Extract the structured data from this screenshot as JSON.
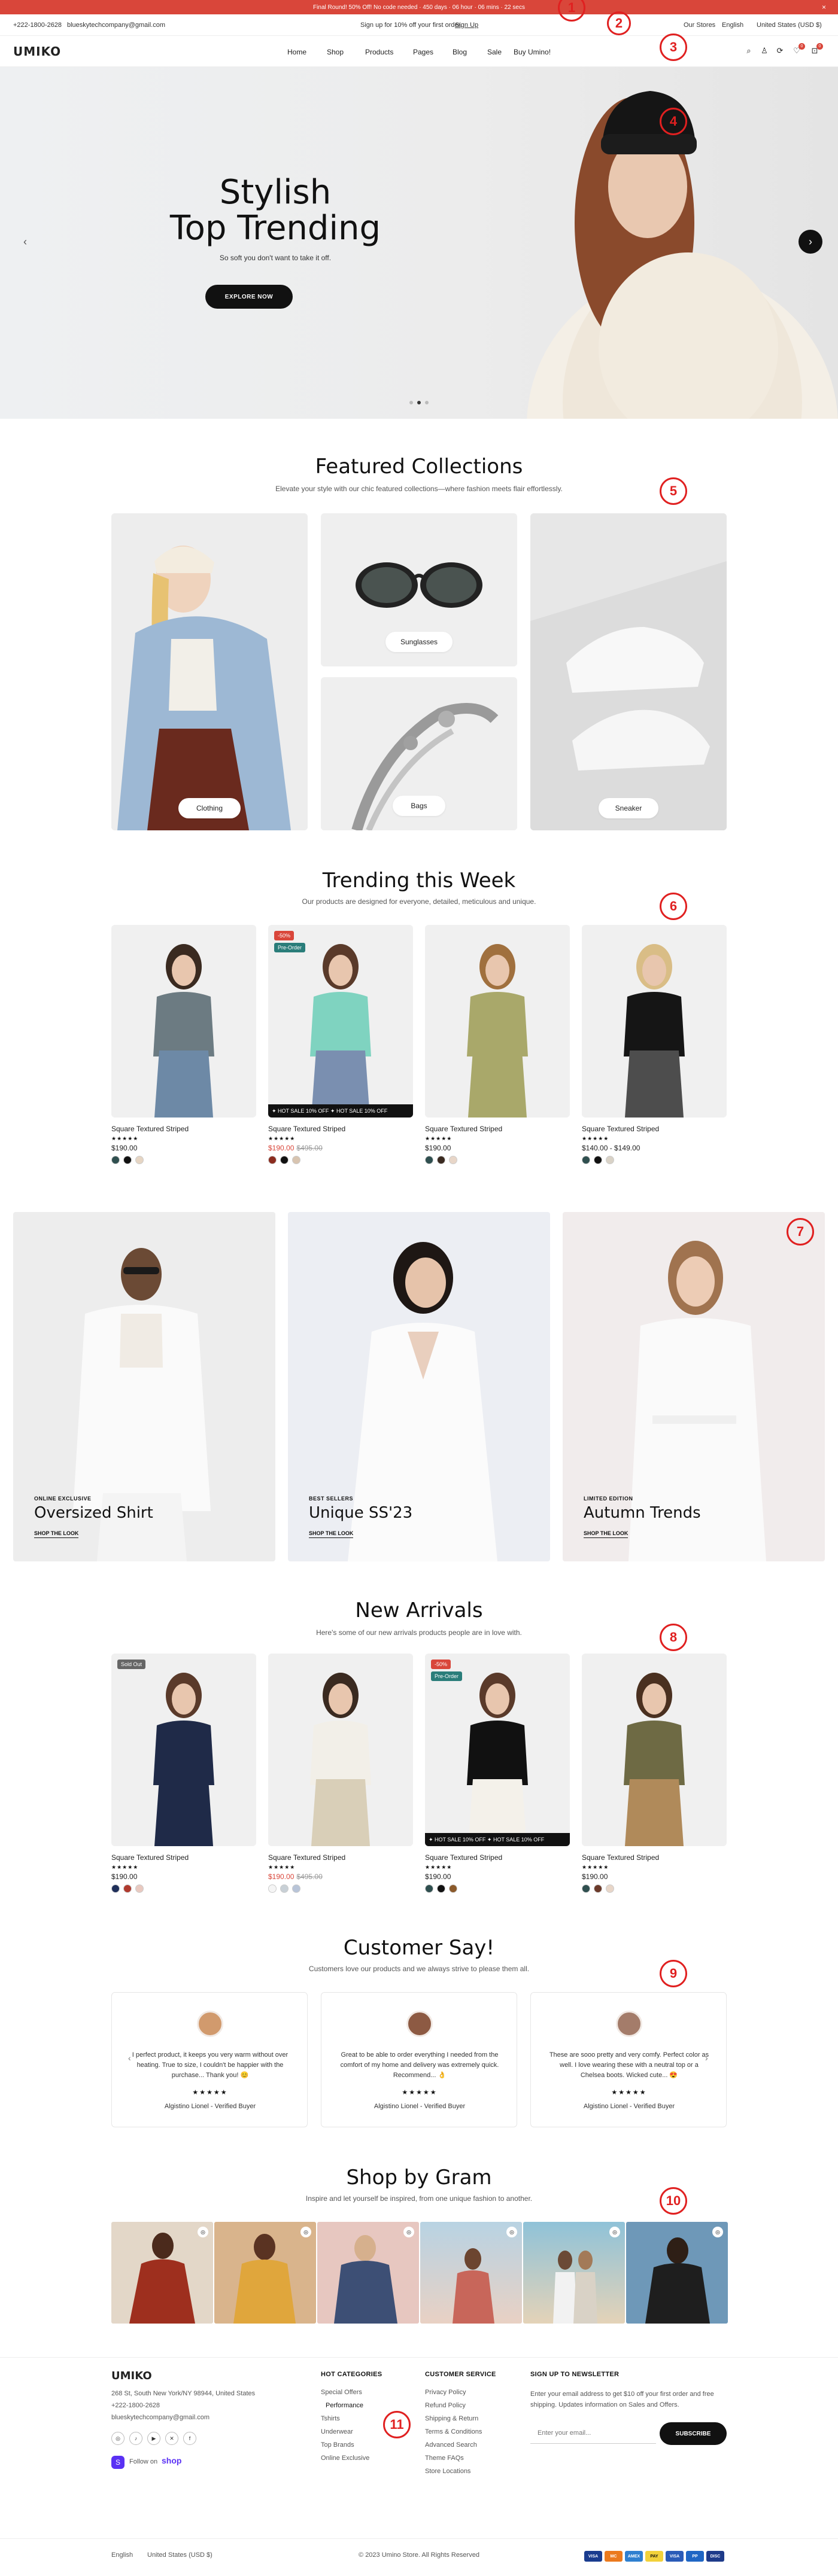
{
  "announcement": {
    "text": "Final Round! 50% Off! No code needed · 450 days · 06 hour · 06 mins · 22 secs",
    "close_icon": "×"
  },
  "topbar": {
    "phone": "+222-1800-2628",
    "email": "blueskytechcompany@gmail.com",
    "promo": "Sign up for 10% off your first order.",
    "signup": "Sign Up",
    "stores": "Our Stores",
    "language": "English",
    "currency": "United States (USD $)"
  },
  "nav": {
    "logo": "UMIKO",
    "items": [
      "Home",
      "Shop",
      "Products",
      "Pages",
      "Blog",
      "Sale",
      "Buy Umino!"
    ],
    "wishlist_count": "0",
    "cart_count": "0"
  },
  "hero": {
    "title_line1": "Stylish",
    "title_line2": "Top Trending",
    "subtitle": "So soft you don't want to take it off.",
    "button": "EXPLORE NOW",
    "prev_icon": "‹",
    "next_icon": "›"
  },
  "markers": [
    "1",
    "2",
    "3",
    "4",
    "5",
    "6",
    "7",
    "8",
    "9",
    "10",
    "11"
  ],
  "featured": {
    "title": "Featured Collections",
    "subtitle": "Elevate your style with our chic featured collections—where fashion meets flair effortlessly.",
    "items": [
      "Clothing",
      "Sunglasses",
      "Bags",
      "Sneaker"
    ]
  },
  "trending": {
    "title": "Trending this Week",
    "subtitle": "Our products are designed for everyone, detailed, meticulous and unique.",
    "products": [
      {
        "name": "Square Textured Striped",
        "stars": "★★★★★",
        "price": "$190.00",
        "old": "",
        "tags": [],
        "marquee": ""
      },
      {
        "name": "Square Textured Striped",
        "stars": "★★★★★",
        "price": "$190.00",
        "old": "$495.00",
        "tags": [
          "-50%",
          "Pre-Order"
        ],
        "marquee": "✦ HOT SALE 10% OFF ✦ HOT SALE 10% OFF"
      },
      {
        "name": "Square Textured Striped",
        "stars": "★★★★★",
        "price": "$190.00",
        "old": "",
        "tags": [],
        "marquee": ""
      },
      {
        "name": "Square Textured Striped",
        "stars": "★★★★★",
        "price": "$140.00 - $149.00",
        "old": "",
        "tags": [],
        "marquee": ""
      }
    ]
  },
  "lookbook": [
    {
      "eyebrow": "ONLINE EXCLUSIVE",
      "title": "Oversized Shirt",
      "link": "SHOP THE LOOK"
    },
    {
      "eyebrow": "BEST SELLERS",
      "title": "Unique SS'23",
      "link": "SHOP THE LOOK"
    },
    {
      "eyebrow": "LIMITED EDITION",
      "title": "Autumn Trends",
      "link": "SHOP THE LOOK"
    }
  ],
  "arrivals": {
    "title": "New Arrivals",
    "subtitle": "Here's some of our new arrivals products people are in love with.",
    "products": [
      {
        "name": "Square Textured Striped",
        "stars": "★★★★★",
        "price": "$190.00",
        "old": "",
        "tags": [
          "Sold Out"
        ],
        "marquee": ""
      },
      {
        "name": "Square Textured Striped",
        "stars": "★★★★★",
        "price": "$190.00",
        "old": "$495.00",
        "tags": [],
        "marquee": ""
      },
      {
        "name": "Square Textured Striped",
        "stars": "★★★★★",
        "price": "$190.00",
        "old": "",
        "tags": [
          "-50%",
          "Pre-Order"
        ],
        "marquee": "✦ HOT SALE 10% OFF ✦ HOT SALE 10% OFF"
      },
      {
        "name": "Square Textured Striped",
        "stars": "★★★★★",
        "price": "$190.00",
        "old": "",
        "tags": [],
        "marquee": ""
      }
    ]
  },
  "testimonials": {
    "title": "Customer Say!",
    "subtitle": "Customers love our products and we always strive to please them all.",
    "items": [
      {
        "text": "I perfect product, it keeps you very warm without over heating. True to size, I couldn't be happier with the purchase... Thank you! 😊",
        "stars": "★★★★★",
        "name": "Algistino Lionel - Verified Buyer"
      },
      {
        "text": "Great to be able to order everything I needed from the comfort of my home and delivery was extremely quick. Recommend... 👌",
        "stars": "★★★★★",
        "name": "Algistino Lionel - Verified Buyer"
      },
      {
        "text": "These are sooo pretty and very comfy. Perfect color as well. I love wearing these with a neutral top or a Chelsea boots. Wicked cute... 😍",
        "stars": "★★★★★",
        "name": "Algistino Lionel - Verified Buyer"
      }
    ]
  },
  "gram": {
    "title": "Shop by Gram",
    "subtitle": "Inspire and let yourself be inspired, from one unique fashion to another."
  },
  "footer": {
    "logo": "UMIKO",
    "address": "268 St, South New York/NY 98944, United States",
    "phone": "+222-1800-2628",
    "email": "blueskytechcompany@gmail.com",
    "follow": "Follow on",
    "shop": "shop",
    "col1_title": "HOT CATEGORIES",
    "col1": [
      "Special Offers",
      "Performance",
      "Tshirts",
      "Underwear",
      "Top Brands",
      "Online Exclusive"
    ],
    "col2_title": "CUSTOMER SERVICE",
    "col2": [
      "Privacy Policy",
      "Refund Policy",
      "Shipping & Return",
      "Terms & Conditions",
      "Advanced Search",
      "Theme FAQs",
      "Store Locations"
    ],
    "col3_title": "SIGN UP TO NEWSLETTER",
    "newsletter_text": "Enter your email address to get $10 off your first order and free shipping. Updates information on Sales and Offers.",
    "email_placeholder": "Enter your email...",
    "subscribe": "SUBSCRIBE",
    "language": "English",
    "currency": "United States (USD $)",
    "copyright": "© 2023 Umino Store. All Rights Reserved",
    "payments": [
      "VISA",
      "MC",
      "AMEX",
      "PAY",
      "VISA",
      "PP",
      "DISC"
    ]
  }
}
